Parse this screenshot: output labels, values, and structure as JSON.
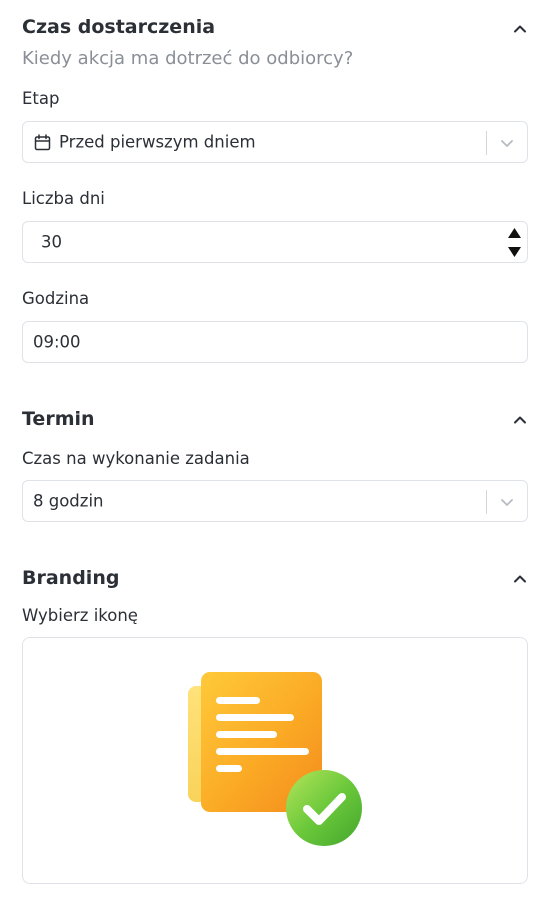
{
  "delivery": {
    "title": "Czas dostarczenia",
    "subtitle": "Kiedy akcja ma dotrzeć do odbiorcy?",
    "stage_label": "Etap",
    "stage_value": "Przed pierwszym dniem",
    "days_label": "Liczba dni",
    "days_value": "30",
    "hour_label": "Godzina",
    "hour_value": "09:00"
  },
  "deadline": {
    "title": "Termin",
    "time_label": "Czas na wykonanie zadania",
    "time_value": "8 godzin"
  },
  "branding": {
    "title": "Branding",
    "icon_label": "Wybierz ikonę",
    "selected_icon": "document-checkmark-icon"
  },
  "icons": {
    "collapse": "chevron-up-icon",
    "dropdown": "chevron-down-icon",
    "calendar": "calendar-icon"
  },
  "colors": {
    "text": "#2b2f36",
    "muted": "#8a8f97",
    "border": "#dfe3e8",
    "document_orange": "#f7a51f",
    "check_green": "#6cc93b"
  }
}
